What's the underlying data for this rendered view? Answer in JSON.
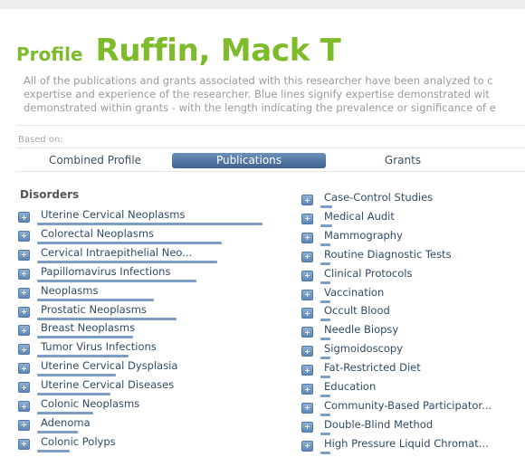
{
  "header": {
    "profile_label": "Profile",
    "researcher_name": "Ruffin, Mack T"
  },
  "description": {
    "line1": "All of the publications and grants associated with this researcher have been analyzed to c",
    "line2": "expertise and experience of the researcher. Blue lines signify expertise demonstrated wit",
    "line3": "demonstrated within grants - with the length indicating the prevalence or significance of e"
  },
  "based_on_label": "Based on:",
  "tabs": [
    {
      "label": "Combined Profile",
      "selected": false
    },
    {
      "label": "Publications",
      "selected": true
    },
    {
      "label": "Grants",
      "selected": false
    }
  ],
  "disorders_heading": "Disorders",
  "left_terms": [
    {
      "label": "Uterine Cervical Neoplasms",
      "prevalence": 0.89
    },
    {
      "label": "Colorectal Neoplasms",
      "prevalence": 0.73
    },
    {
      "label": "Cervical Intraepithelial Neo...",
      "prevalence": 0.71
    },
    {
      "label": "Papillomavirus Infections",
      "prevalence": 0.63
    },
    {
      "label": "Neoplasms",
      "prevalence": 0.46
    },
    {
      "label": "Prostatic Neoplasms",
      "prevalence": 0.55
    },
    {
      "label": "Breast Neoplasms",
      "prevalence": 0.38
    },
    {
      "label": "Tumor Virus Infections",
      "prevalence": 0.36
    },
    {
      "label": "Uterine Cervical Dysplasia",
      "prevalence": 0.31
    },
    {
      "label": "Uterine Cervical Diseases",
      "prevalence": 0.29
    },
    {
      "label": "Colonic Neoplasms",
      "prevalence": 0.22
    },
    {
      "label": "Adenoma",
      "prevalence": 0.16
    },
    {
      "label": "Colonic Polyps",
      "prevalence": 0.13
    }
  ],
  "right_terms": [
    {
      "label": "Case-Control Studies",
      "prevalence": 0.06
    },
    {
      "label": "Medical Audit",
      "prevalence": 0.06
    },
    {
      "label": "Mammography",
      "prevalence": 0.05
    },
    {
      "label": "Routine Diagnostic Tests",
      "prevalence": 0.05
    },
    {
      "label": "Clinical Protocols",
      "prevalence": 0.05
    },
    {
      "label": "Vaccination",
      "prevalence": 0.05
    },
    {
      "label": "Occult Blood",
      "prevalence": 0.05
    },
    {
      "label": "Needle Biopsy",
      "prevalence": 0.05
    },
    {
      "label": "Sigmoidoscopy",
      "prevalence": 0.05
    },
    {
      "label": "Fat-Restricted Diet",
      "prevalence": 0.05
    },
    {
      "label": "Education",
      "prevalence": 0.05
    },
    {
      "label": "Community-Based Participator...",
      "prevalence": 0.05
    },
    {
      "label": "Double-Blind Method",
      "prevalence": 0.05
    },
    {
      "label": "High Pressure Liquid Chromat...",
      "prevalence": 0.05
    }
  ],
  "colors": {
    "accent_green": "#7dbb2a",
    "expertise_blue": "#7b9dc6",
    "selected_tab": "#4a6e99"
  },
  "icons": {
    "expand": "plus-icon"
  }
}
